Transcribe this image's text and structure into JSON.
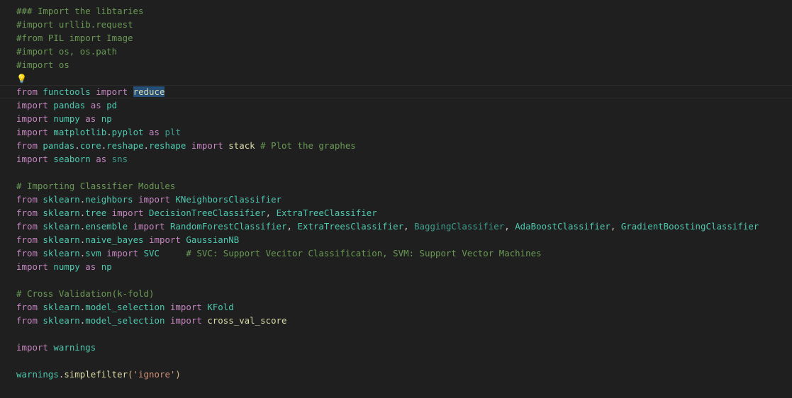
{
  "theme": {
    "background": "#1f1f1f",
    "colors": {
      "comment": "#6a9955",
      "keyword": "#c586c0",
      "module": "#4ec9b0",
      "name": "#4ec9b0",
      "func": "#dcdcaa",
      "string": "#ce9178",
      "plain": "#cccccc",
      "dim": "#3e9e8e",
      "paren": "#d7ba7d"
    }
  },
  "editor": {
    "lightbulb_icon": "💡",
    "lines": [
      [
        {
          "t": "### Import the libtaries",
          "c": "comment"
        }
      ],
      [
        {
          "t": "#import urllib.request",
          "c": "comment"
        }
      ],
      [
        {
          "t": "#from PIL import Image",
          "c": "comment"
        }
      ],
      [
        {
          "t": "#import os, os.path",
          "c": "comment"
        }
      ],
      [
        {
          "t": "#import os",
          "c": "comment"
        }
      ],
      [
        {
          "icon": "lightbulb"
        }
      ],
      [
        {
          "t": "from",
          "c": "keyword"
        },
        {
          "t": " ",
          "c": "plain"
        },
        {
          "t": "functools",
          "c": "module"
        },
        {
          "t": " ",
          "c": "plain"
        },
        {
          "t": "import",
          "c": "keyword"
        },
        {
          "t": " ",
          "c": "plain"
        },
        {
          "t": "reduce",
          "c": "func",
          "hl": true
        }
      ],
      [
        {
          "t": "import",
          "c": "keyword"
        },
        {
          "t": " ",
          "c": "plain"
        },
        {
          "t": "pandas",
          "c": "module"
        },
        {
          "t": " ",
          "c": "plain"
        },
        {
          "t": "as",
          "c": "keyword"
        },
        {
          "t": " ",
          "c": "plain"
        },
        {
          "t": "pd",
          "c": "module"
        }
      ],
      [
        {
          "t": "import",
          "c": "keyword"
        },
        {
          "t": " ",
          "c": "plain"
        },
        {
          "t": "numpy",
          "c": "module"
        },
        {
          "t": " ",
          "c": "plain"
        },
        {
          "t": "as",
          "c": "keyword"
        },
        {
          "t": " ",
          "c": "plain"
        },
        {
          "t": "np",
          "c": "module"
        }
      ],
      [
        {
          "t": "import",
          "c": "keyword"
        },
        {
          "t": " ",
          "c": "plain"
        },
        {
          "t": "matplotlib",
          "c": "module"
        },
        {
          "t": ".",
          "c": "plain"
        },
        {
          "t": "pyplot",
          "c": "module"
        },
        {
          "t": " ",
          "c": "plain"
        },
        {
          "t": "as",
          "c": "keyword"
        },
        {
          "t": " ",
          "c": "plain"
        },
        {
          "t": "plt",
          "c": "dim"
        }
      ],
      [
        {
          "t": "from",
          "c": "keyword"
        },
        {
          "t": " ",
          "c": "plain"
        },
        {
          "t": "pandas",
          "c": "module"
        },
        {
          "t": ".",
          "c": "plain"
        },
        {
          "t": "core",
          "c": "module"
        },
        {
          "t": ".",
          "c": "plain"
        },
        {
          "t": "reshape",
          "c": "module"
        },
        {
          "t": ".",
          "c": "plain"
        },
        {
          "t": "reshape",
          "c": "module"
        },
        {
          "t": " ",
          "c": "plain"
        },
        {
          "t": "import",
          "c": "keyword"
        },
        {
          "t": " ",
          "c": "plain"
        },
        {
          "t": "stack",
          "c": "func"
        },
        {
          "t": " ",
          "c": "plain"
        },
        {
          "t": "# Plot the graphes",
          "c": "comment"
        }
      ],
      [
        {
          "t": "import",
          "c": "keyword"
        },
        {
          "t": " ",
          "c": "plain"
        },
        {
          "t": "seaborn",
          "c": "module"
        },
        {
          "t": " ",
          "c": "plain"
        },
        {
          "t": "as",
          "c": "keyword"
        },
        {
          "t": " ",
          "c": "plain"
        },
        {
          "t": "sns",
          "c": "dim"
        }
      ],
      [],
      [
        {
          "t": "# Importing Classifier Modules",
          "c": "comment"
        }
      ],
      [
        {
          "t": "from",
          "c": "keyword"
        },
        {
          "t": " ",
          "c": "plain"
        },
        {
          "t": "sklearn",
          "c": "module"
        },
        {
          "t": ".",
          "c": "plain"
        },
        {
          "t": "neighbors",
          "c": "module"
        },
        {
          "t": " ",
          "c": "plain"
        },
        {
          "t": "import",
          "c": "keyword"
        },
        {
          "t": " ",
          "c": "plain"
        },
        {
          "t": "KNeighborsClassifier",
          "c": "name"
        }
      ],
      [
        {
          "t": "from",
          "c": "keyword"
        },
        {
          "t": " ",
          "c": "plain"
        },
        {
          "t": "sklearn",
          "c": "module"
        },
        {
          "t": ".",
          "c": "plain"
        },
        {
          "t": "tree",
          "c": "module"
        },
        {
          "t": " ",
          "c": "plain"
        },
        {
          "t": "import",
          "c": "keyword"
        },
        {
          "t": " ",
          "c": "plain"
        },
        {
          "t": "DecisionTreeClassifier",
          "c": "name"
        },
        {
          "t": ", ",
          "c": "plain"
        },
        {
          "t": "ExtraTreeClassifier",
          "c": "name"
        }
      ],
      [
        {
          "t": "from",
          "c": "keyword"
        },
        {
          "t": " ",
          "c": "plain"
        },
        {
          "t": "sklearn",
          "c": "module"
        },
        {
          "t": ".",
          "c": "plain"
        },
        {
          "t": "ensemble",
          "c": "module"
        },
        {
          "t": " ",
          "c": "plain"
        },
        {
          "t": "import",
          "c": "keyword"
        },
        {
          "t": " ",
          "c": "plain"
        },
        {
          "t": "RandomForestClassifier",
          "c": "name"
        },
        {
          "t": ", ",
          "c": "plain"
        },
        {
          "t": "ExtraTreesClassifier",
          "c": "name"
        },
        {
          "t": ", ",
          "c": "plain"
        },
        {
          "t": "BaggingClassifier",
          "c": "dim"
        },
        {
          "t": ", ",
          "c": "plain"
        },
        {
          "t": "AdaBoostClassifier",
          "c": "name"
        },
        {
          "t": ", ",
          "c": "plain"
        },
        {
          "t": "GradientBoostingClassifier",
          "c": "name"
        }
      ],
      [
        {
          "t": "from",
          "c": "keyword"
        },
        {
          "t": " ",
          "c": "plain"
        },
        {
          "t": "sklearn",
          "c": "module"
        },
        {
          "t": ".",
          "c": "plain"
        },
        {
          "t": "naive_bayes",
          "c": "module"
        },
        {
          "t": " ",
          "c": "plain"
        },
        {
          "t": "import",
          "c": "keyword"
        },
        {
          "t": " ",
          "c": "plain"
        },
        {
          "t": "GaussianNB",
          "c": "name"
        }
      ],
      [
        {
          "t": "from",
          "c": "keyword"
        },
        {
          "t": " ",
          "c": "plain"
        },
        {
          "t": "sklearn",
          "c": "module"
        },
        {
          "t": ".",
          "c": "plain"
        },
        {
          "t": "svm",
          "c": "module"
        },
        {
          "t": " ",
          "c": "plain"
        },
        {
          "t": "import",
          "c": "keyword"
        },
        {
          "t": " ",
          "c": "plain"
        },
        {
          "t": "SVC",
          "c": "name"
        },
        {
          "t": "     ",
          "c": "plain"
        },
        {
          "t": "# SVC: Support Vecitor Classification, SVM: Support Vector Machines",
          "c": "comment"
        }
      ],
      [
        {
          "t": "import",
          "c": "keyword"
        },
        {
          "t": " ",
          "c": "plain"
        },
        {
          "t": "numpy",
          "c": "module"
        },
        {
          "t": " ",
          "c": "plain"
        },
        {
          "t": "as",
          "c": "keyword"
        },
        {
          "t": " ",
          "c": "plain"
        },
        {
          "t": "np",
          "c": "module"
        }
      ],
      [],
      [
        {
          "t": "# Cross Validation(k-fold)",
          "c": "comment"
        }
      ],
      [
        {
          "t": "from",
          "c": "keyword"
        },
        {
          "t": " ",
          "c": "plain"
        },
        {
          "t": "sklearn",
          "c": "module"
        },
        {
          "t": ".",
          "c": "plain"
        },
        {
          "t": "model_selection",
          "c": "module"
        },
        {
          "t": " ",
          "c": "plain"
        },
        {
          "t": "import",
          "c": "keyword"
        },
        {
          "t": " ",
          "c": "plain"
        },
        {
          "t": "KFold",
          "c": "name"
        }
      ],
      [
        {
          "t": "from",
          "c": "keyword"
        },
        {
          "t": " ",
          "c": "plain"
        },
        {
          "t": "sklearn",
          "c": "module"
        },
        {
          "t": ".",
          "c": "plain"
        },
        {
          "t": "model_selection",
          "c": "module"
        },
        {
          "t": " ",
          "c": "plain"
        },
        {
          "t": "import",
          "c": "keyword"
        },
        {
          "t": " ",
          "c": "plain"
        },
        {
          "t": "cross_val_score",
          "c": "func"
        }
      ],
      [],
      [
        {
          "t": "import",
          "c": "keyword"
        },
        {
          "t": " ",
          "c": "plain"
        },
        {
          "t": "warnings",
          "c": "module"
        }
      ],
      [],
      [
        {
          "t": "warnings",
          "c": "module"
        },
        {
          "t": ".",
          "c": "plain"
        },
        {
          "t": "simplefilter",
          "c": "func"
        },
        {
          "t": "(",
          "c": "paren"
        },
        {
          "t": "'ignore'",
          "c": "string"
        },
        {
          "t": ")",
          "c": "paren"
        }
      ]
    ]
  }
}
